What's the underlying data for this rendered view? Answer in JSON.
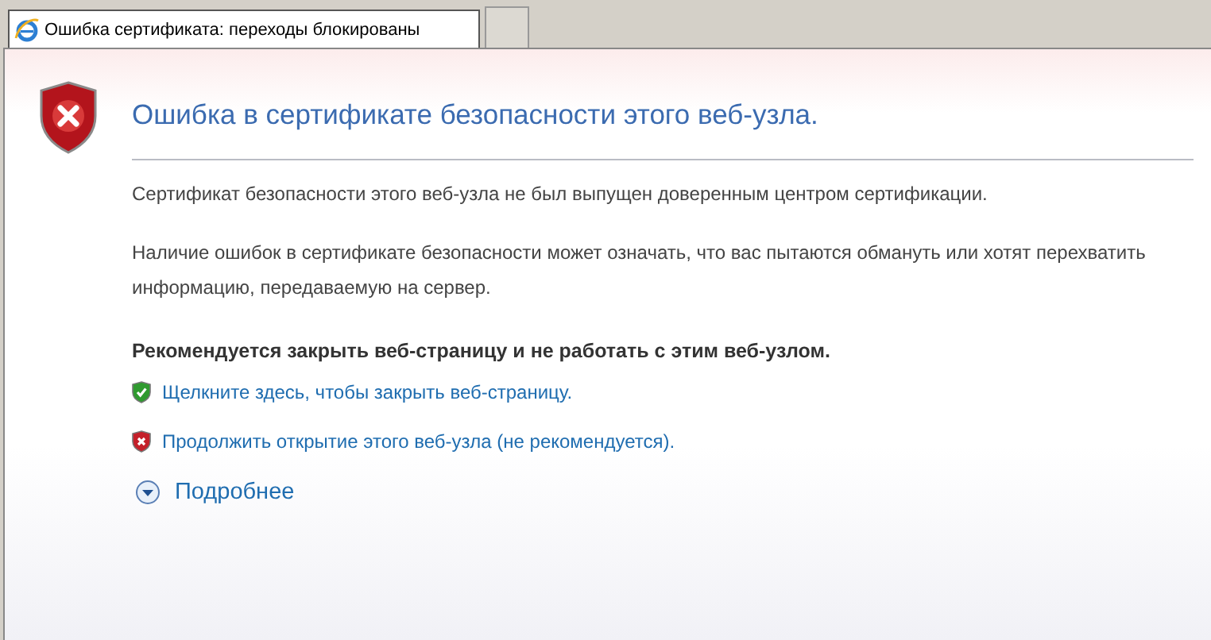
{
  "tabs": [
    {
      "label": "Ошибка сертификата: переходы блокированы",
      "selected": true
    }
  ],
  "page": {
    "title": "Ошибка в сертификате безопасности этого веб-узла.",
    "paragraphs": [
      "Сертификат безопасности этого веб-узла не был выпущен доверенным центром сертификации.",
      "Наличие ошибок в сертификате безопасности может означать, что вас пытаются обмануть или хотят перехватить информацию, передаваемую на сервер."
    ],
    "recommendation": "Рекомендуется закрыть веб-страницу и не работать с этим веб-узлом.",
    "links": [
      {
        "kind": "safe",
        "label": "Щелкните здесь, чтобы закрыть веб-страницу."
      },
      {
        "kind": "unsafe",
        "label": "Продолжить открытие этого веб-узла (не рекомендуется)."
      }
    ],
    "details": {
      "label": "Подробнее",
      "expanded": false
    }
  }
}
